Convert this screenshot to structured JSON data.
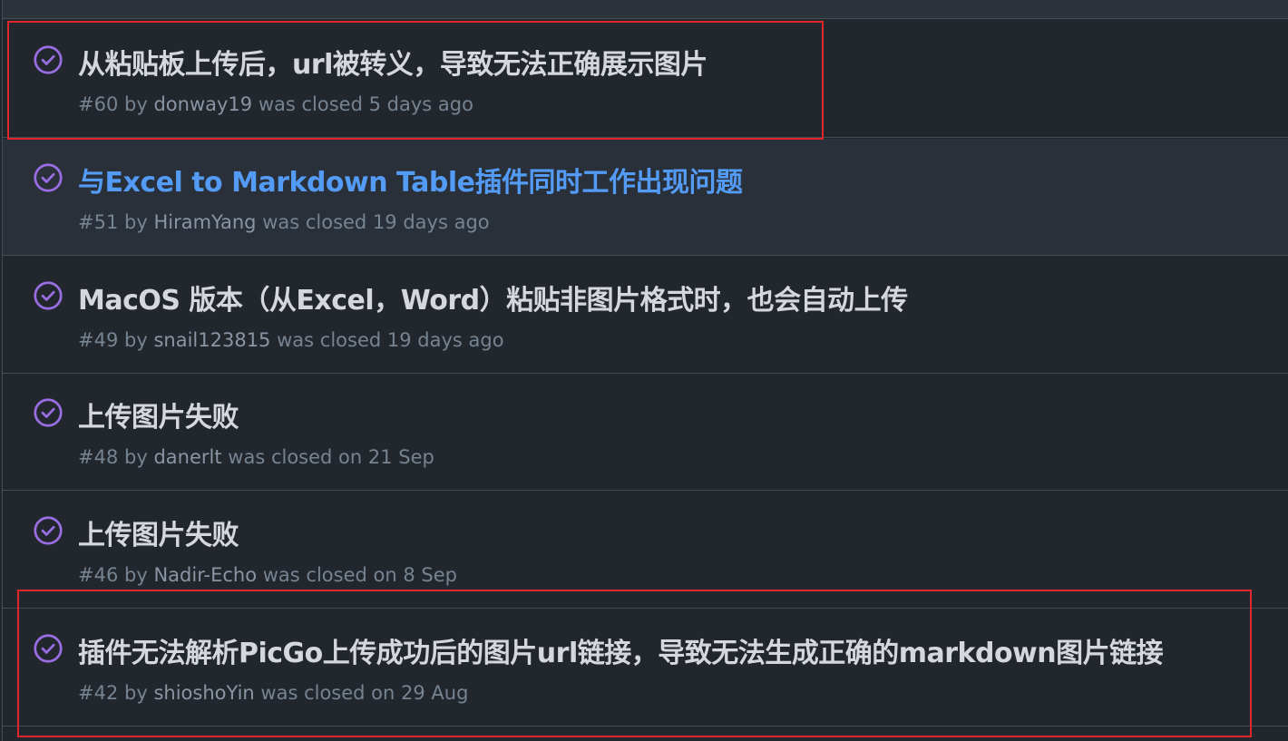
{
  "issues": [
    {
      "number": "#60",
      "by": "by",
      "author": "donway19",
      "closed_text": "was closed 5 days ago",
      "title": "从粘贴板上传后，url被转义，导致无法正确展示图片"
    },
    {
      "number": "#51",
      "by": "by",
      "author": "HiramYang",
      "closed_text": "was closed 19 days ago",
      "title": "与Excel to Markdown Table插件同时工作出现问题"
    },
    {
      "number": "#49",
      "by": "by",
      "author": "snail123815",
      "closed_text": "was closed 19 days ago",
      "title": "MacOS 版本（从Excel，Word）粘贴非图片格式时，也会自动上传"
    },
    {
      "number": "#48",
      "by": "by",
      "author": "danerlt",
      "closed_text": "was closed on 21 Sep",
      "title": "上传图片失败"
    },
    {
      "number": "#46",
      "by": "by",
      "author": "Nadir-Echo",
      "closed_text": "was closed on 8 Sep",
      "title": "上传图片失败"
    },
    {
      "number": "#42",
      "by": "by",
      "author": "shioshoYin",
      "closed_text": "was closed on 29 Aug",
      "title": "插件无法解析PicGo上传成功后的图片url链接，导致无法生成正确的markdown图片链接"
    }
  ],
  "colors": {
    "background": "#22272e",
    "closed_icon": "#986ee2",
    "highlight_box": "#e0262a",
    "link_hover": "#539bf5"
  },
  "icons": {
    "closed": "issue-closed-icon"
  }
}
